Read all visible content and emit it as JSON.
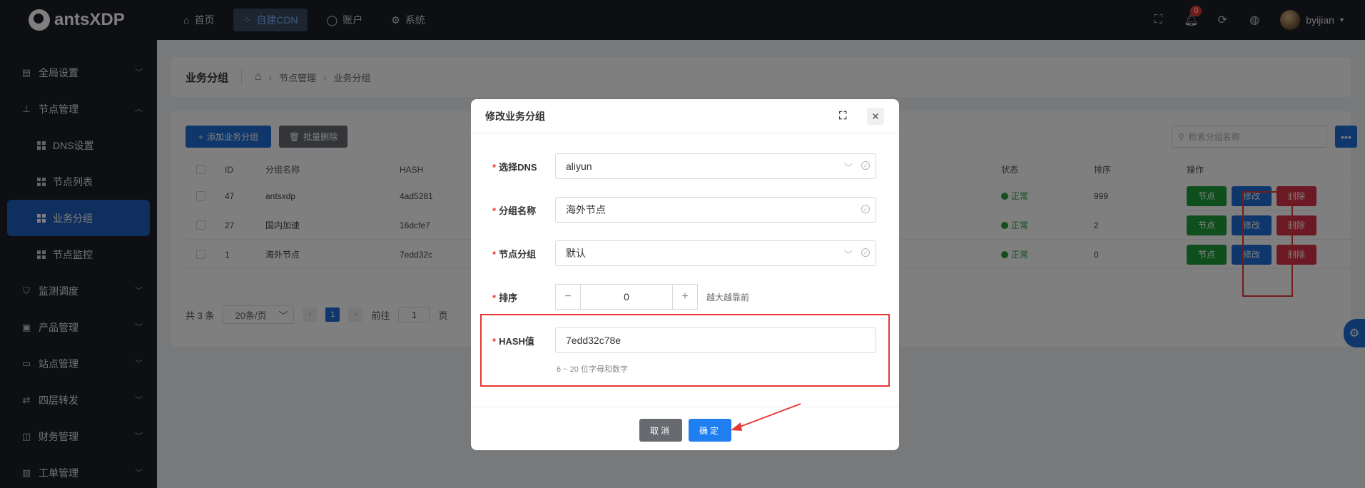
{
  "app": {
    "brand": "antsXDP"
  },
  "topnav": {
    "items": [
      {
        "label": "首页",
        "icon": "home-icon"
      },
      {
        "label": "自建CDN",
        "icon": "cdn-icon"
      },
      {
        "label": "账户",
        "icon": "user-icon"
      },
      {
        "label": "系统",
        "icon": "gear-icon"
      }
    ],
    "notification_count": "0",
    "username": "byijian"
  },
  "sidebar": {
    "items": [
      {
        "label": "全局设置"
      },
      {
        "label": "节点管理"
      },
      {
        "label": "DNS设置"
      },
      {
        "label": "节点列表"
      },
      {
        "label": "业务分组"
      },
      {
        "label": "节点监控"
      },
      {
        "label": "监测调度"
      },
      {
        "label": "产品管理"
      },
      {
        "label": "站点管理"
      },
      {
        "label": "四层转发"
      },
      {
        "label": "财务管理"
      },
      {
        "label": "工单管理"
      }
    ]
  },
  "page": {
    "title": "业务分组",
    "breadcrumb": [
      "节点管理",
      "业务分组"
    ],
    "add_button": "添加业务分组",
    "batch_delete_button": "批量删除",
    "search_placeholder": "检索分组名称",
    "more_label": "•••"
  },
  "table": {
    "headers": {
      "id": "ID",
      "name": "分组名称",
      "hash": "HASH",
      "status": "状态",
      "sort": "排序",
      "op": "操作"
    },
    "rows": [
      {
        "id": "47",
        "name": "antsxdp",
        "hash": "4ad5281",
        "status": "正常",
        "sort": "999"
      },
      {
        "id": "27",
        "name": "国内加速",
        "hash": "16dcfe7",
        "status": "正常",
        "sort": "2"
      },
      {
        "id": "1",
        "name": "海外节点",
        "hash": "7edd32c",
        "status": "正常",
        "sort": "0"
      }
    ],
    "op_labels": {
      "node": "节点",
      "edit": "修改",
      "delete": "删除"
    }
  },
  "pager": {
    "total": "共 3 条",
    "page_size": "20条/页",
    "current": "1",
    "goto_prefix": "前往",
    "goto_value": "1",
    "goto_suffix": "页"
  },
  "modal": {
    "title": "修改业务分组",
    "fields": {
      "dns_label": "选择DNS",
      "dns_value": "aliyun",
      "name_label": "分组名称",
      "name_value": "海外节点",
      "node_group_label": "节点分组",
      "node_group_value": "默认",
      "sort_label": "排序",
      "sort_value": "0",
      "sort_hint": "越大越靠前",
      "hash_label": "HASH值",
      "hash_value": "7edd32c78e",
      "hash_help": "6 ~ 20 位字母和数字"
    },
    "cancel_label": "取消",
    "ok_label": "确定"
  },
  "colors": {
    "accent": "#1f6fd6",
    "danger": "#d9304a",
    "success": "#1e9e3a",
    "highlight_box": "#e53935"
  }
}
